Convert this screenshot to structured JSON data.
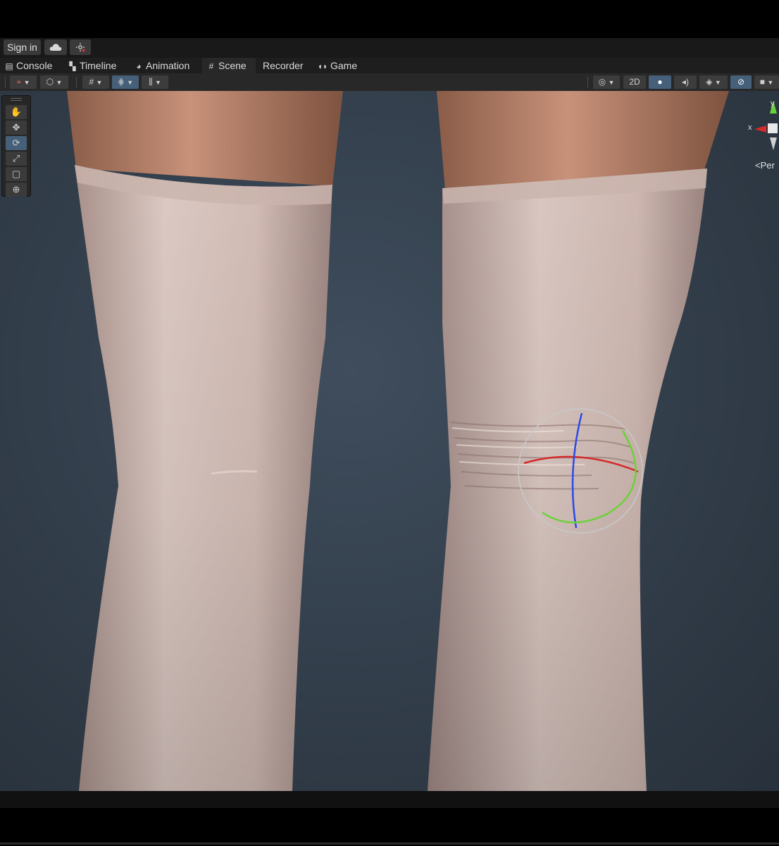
{
  "account_bar": {
    "sign_in_label": "Sign in",
    "cloud_icon": "cloud-icon",
    "collab_icon": "collab-icon"
  },
  "tabs": [
    {
      "label": "Console",
      "icon": "console-icon"
    },
    {
      "label": "Timeline",
      "icon": "timeline-icon"
    },
    {
      "label": "Animation",
      "icon": "animation-icon"
    },
    {
      "label": "Scene",
      "icon": "scene-hash-icon",
      "active": true
    },
    {
      "label": "Recorder",
      "icon": ""
    },
    {
      "label": "Game",
      "icon": "gamepad-icon"
    }
  ],
  "scene_toolbar": {
    "mode_2d_label": "2D",
    "lighting_icon": "lightbulb-icon",
    "audio_icon": "audio-icon",
    "effects_icon": "layers-icon",
    "hidden_toggle_icon": "visibility-icon",
    "camera_icon": "camera-icon"
  },
  "tools": [
    {
      "name": "view-tool",
      "icon": "hand-icon"
    },
    {
      "name": "move-tool",
      "icon": "move-arrows-icon"
    },
    {
      "name": "rotate-tool",
      "icon": "rotate-icon",
      "active": true
    },
    {
      "name": "scale-tool",
      "icon": "scale-icon"
    },
    {
      "name": "rect-tool",
      "icon": "rect-icon"
    },
    {
      "name": "transform-tool",
      "icon": "transform-icon"
    }
  ],
  "gizmo": {
    "y_label": "y",
    "x_label": "x",
    "projection_label": "Per"
  },
  "colors": {
    "axis_x": "#d42a2a",
    "axis_y": "#6ad23a",
    "axis_z": "#2a4ae6",
    "active_tool": "#46607a",
    "viewport_bg": "#34404d"
  }
}
